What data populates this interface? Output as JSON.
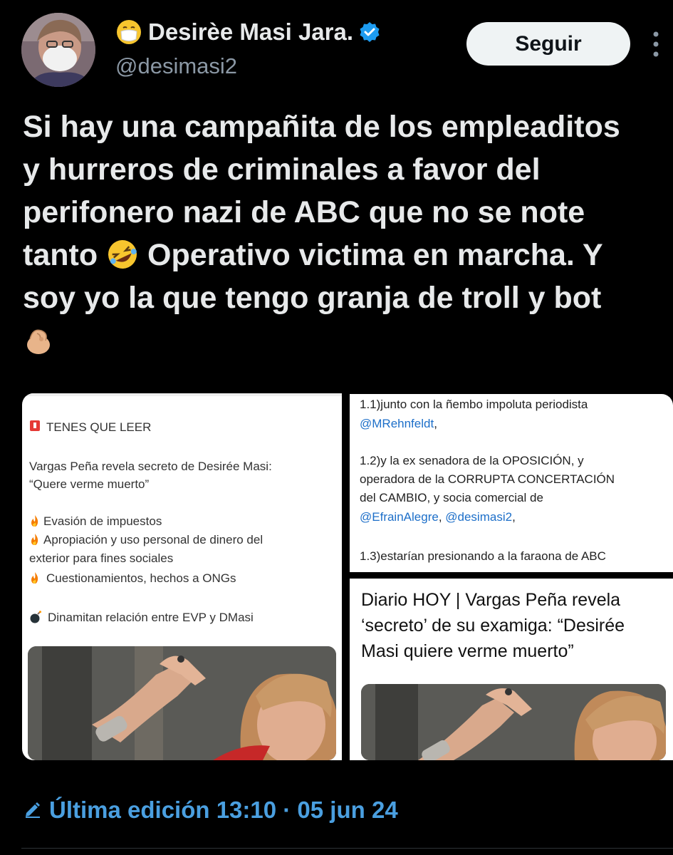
{
  "author": {
    "name": "Desirèe Masi Jara.",
    "handle": "@desimasi2",
    "name_emoji": "mask-face-emoji",
    "verified_icon": "verified-badge-icon"
  },
  "follow_label": "Seguir",
  "tweet": {
    "lines": [
      "Si hay una campañita de los empleaditos",
      "y hurreros de criminales a favor del",
      "perifonero nazi de ABC que no se note",
      "tanto",
      "Operativo victima en marcha. Y",
      "soy yo la que tengo granja de troll y bot"
    ]
  },
  "card_left": {
    "header": "TENES QUE LEER",
    "headline_1": "Vargas Peña revela secreto de Desirée Masi:",
    "headline_2": "“Quere verme muerto”",
    "bullets": [
      "Evasión de impuestos",
      "Apropiación y uso personal de dinero del",
      "exterior para fines sociales",
      "Cuestionamientos, hechos a ONGs"
    ],
    "bomb_line": "Dinamitan relación entre EVP y DMasi"
  },
  "card_top_right": {
    "l1": "1.1)junto con la ñembo impoluta periodista",
    "l1_mention": "@MRehnfeldt",
    "l1_tail": ",",
    "l2": "1.2)y la ex senadora de la OPOSICIÓN, y",
    "l3": "operadora de la CORRUPTA CONCERTACIÓN",
    "l4": "del CAMBIO, y socia comercial de",
    "l5_mention_a": "@EfrainAlegre",
    "l5_sep": ", ",
    "l5_mention_b": "@desimasi2",
    "l5_tail": ",",
    "l6": "1.3)estarían presionando a la faraona de ABC"
  },
  "card_bottom_right": {
    "headline": "Diario HOY | Vargas Peña revela ‘secreto’ de su examiga: “Desirée Masi quiere verme muerto”"
  },
  "edited": {
    "label": "Última edición 13:10 · 05 jun 24",
    "icon": "pencil-icon"
  },
  "colors": {
    "background": "#000000",
    "text": "#e7e9ea",
    "handle": "#8b98a5",
    "link": "#4a9fe0",
    "mention": "#1d6fc9",
    "verified": "#1d9bf0"
  }
}
